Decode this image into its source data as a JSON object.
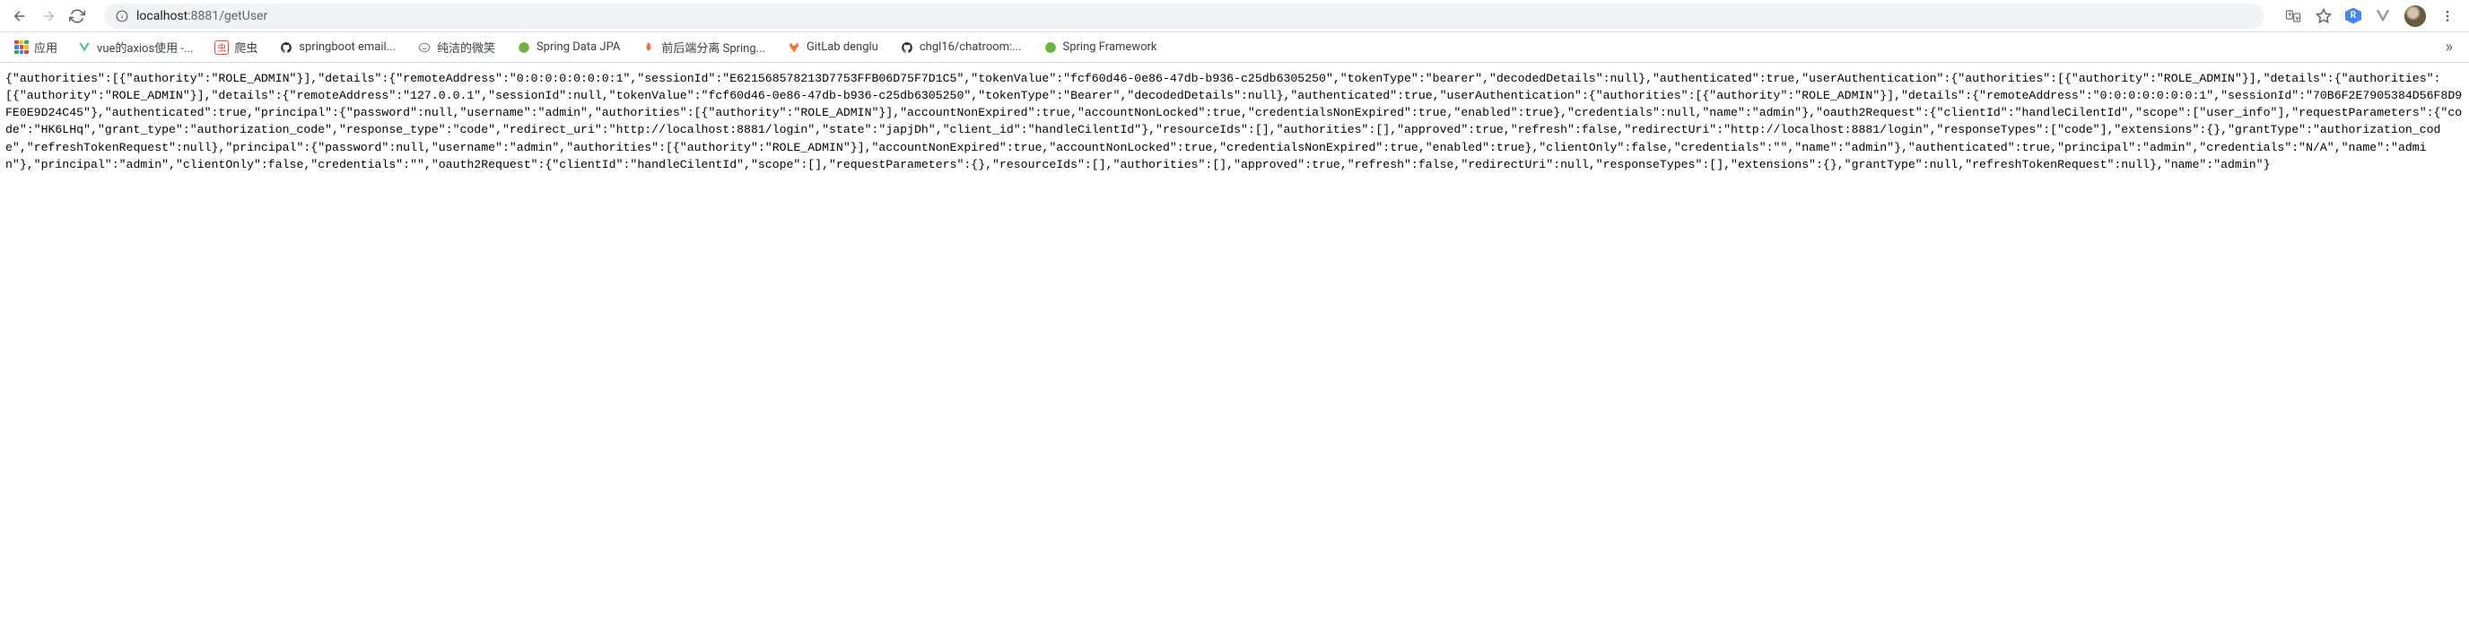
{
  "url": {
    "host": "localhost",
    "port_path": ":8881/getUser"
  },
  "bookmarks_bar": {
    "apps_label": "应用",
    "items": [
      {
        "label": "vue的axios使用 -...",
        "icon": "vue"
      },
      {
        "label": "爬虫",
        "icon": "red-box"
      },
      {
        "label": "springboot email...",
        "icon": "github"
      },
      {
        "label": "纯洁的微笑",
        "icon": "smile"
      },
      {
        "label": "Spring Data JPA",
        "icon": "spring"
      },
      {
        "label": "前后端分离 Spring...",
        "icon": "fire"
      },
      {
        "label": "GitLab denglu",
        "icon": "gitlab"
      },
      {
        "label": "chgl16/chatroom:...",
        "icon": "github"
      },
      {
        "label": "Spring Framework",
        "icon": "spring"
      }
    ],
    "more": "»"
  },
  "response_body": "{\"authorities\":[{\"authority\":\"ROLE_ADMIN\"}],\"details\":{\"remoteAddress\":\"0:0:0:0:0:0:0:1\",\"sessionId\":\"E621568578213D7753FFB06D75F7D1C5\",\"tokenValue\":\"fcf60d46-0e86-47db-b936-c25db6305250\",\"tokenType\":\"bearer\",\"decodedDetails\":null},\"authenticated\":true,\"userAuthentication\":{\"authorities\":[{\"authority\":\"ROLE_ADMIN\"}],\"details\":{\"authorities\":[{\"authority\":\"ROLE_ADMIN\"}],\"details\":{\"remoteAddress\":\"127.0.0.1\",\"sessionId\":null,\"tokenValue\":\"fcf60d46-0e86-47db-b936-c25db6305250\",\"tokenType\":\"Bearer\",\"decodedDetails\":null},\"authenticated\":true,\"userAuthentication\":{\"authorities\":[{\"authority\":\"ROLE_ADMIN\"}],\"details\":{\"remoteAddress\":\"0:0:0:0:0:0:0:1\",\"sessionId\":\"70B6F2E7905384D56F8D9FE0E9D24C45\"},\"authenticated\":true,\"principal\":{\"password\":null,\"username\":\"admin\",\"authorities\":[{\"authority\":\"ROLE_ADMIN\"}],\"accountNonExpired\":true,\"accountNonLocked\":true,\"credentialsNonExpired\":true,\"enabled\":true},\"credentials\":null,\"name\":\"admin\"},\"oauth2Request\":{\"clientId\":\"handleCilentId\",\"scope\":[\"user_info\"],\"requestParameters\":{\"code\":\"HK6LHq\",\"grant_type\":\"authorization_code\",\"response_type\":\"code\",\"redirect_uri\":\"http://localhost:8881/login\",\"state\":\"japjDh\",\"client_id\":\"handleCilentId\"},\"resourceIds\":[],\"authorities\":[],\"approved\":true,\"refresh\":false,\"redirectUri\":\"http://localhost:8881/login\",\"responseTypes\":[\"code\"],\"extensions\":{},\"grantType\":\"authorization_code\",\"refreshTokenRequest\":null},\"principal\":{\"password\":null,\"username\":\"admin\",\"authorities\":[{\"authority\":\"ROLE_ADMIN\"}],\"accountNonExpired\":true,\"accountNonLocked\":true,\"credentialsNonExpired\":true,\"enabled\":true},\"clientOnly\":false,\"credentials\":\"\",\"name\":\"admin\"},\"authenticated\":true,\"principal\":\"admin\",\"credentials\":\"N/A\",\"name\":\"admin\"},\"principal\":\"admin\",\"clientOnly\":false,\"credentials\":\"\",\"oauth2Request\":{\"clientId\":\"handleCilentId\",\"scope\":[],\"requestParameters\":{},\"resourceIds\":[],\"authorities\":[],\"approved\":true,\"refresh\":false,\"redirectUri\":null,\"responseTypes\":[],\"extensions\":{},\"grantType\":null,\"refreshTokenRequest\":null},\"name\":\"admin\"}"
}
